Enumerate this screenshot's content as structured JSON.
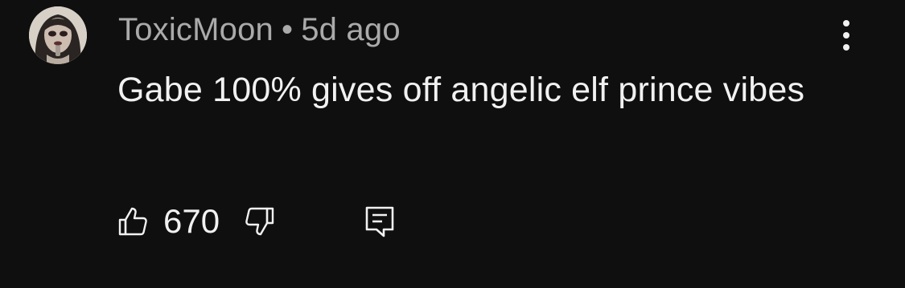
{
  "comment": {
    "author": "ToxicMoon",
    "separator": "•",
    "timestamp": "5d ago",
    "text": "Gabe 100% gives off angelic elf prince vibes",
    "like_count": "670",
    "icons": {
      "avatar": "user-avatar",
      "more": "more-vert-icon",
      "like": "thumbs-up-icon",
      "dislike": "thumbs-down-icon",
      "reply": "reply-comment-icon"
    }
  },
  "colors": {
    "background": "#0f0f0f",
    "primary_text": "#f1f1f1",
    "secondary_text": "#aaaaaa"
  }
}
